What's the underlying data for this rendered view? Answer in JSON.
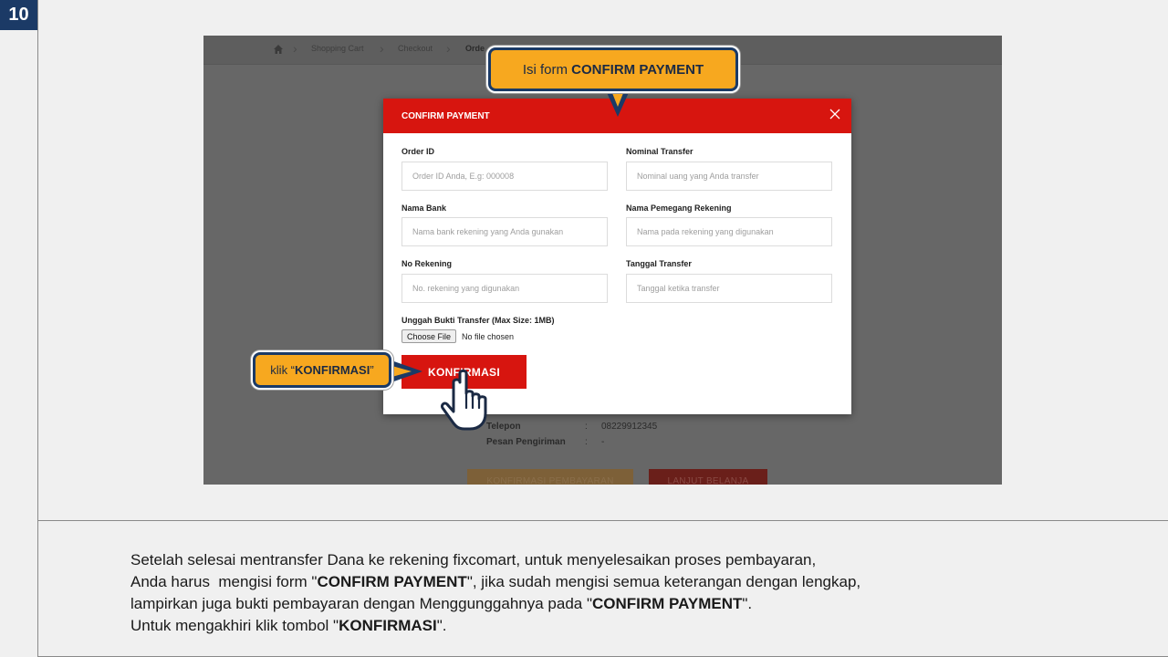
{
  "step_number": "10",
  "screenshot": {
    "breadcrumb": {
      "home_icon": "home-icon",
      "items": [
        "Shopping Cart",
        "Checkout",
        "Orde"
      ]
    },
    "background_details": {
      "telepon_label": "Telepon",
      "telepon_value": "08229912345",
      "pesan_label": "Pesan Pengiriman",
      "pesan_value": "-"
    },
    "background_buttons": {
      "confirm_label": "KONFIRMASI PEMBAYARAN",
      "continue_label": "LANJUT BELANJA"
    },
    "modal": {
      "title": "CONFIRM PAYMENT",
      "close_icon": "close-icon",
      "fields": {
        "order_id": {
          "label": "Order ID",
          "placeholder": "Order ID Anda, E.g: 000008"
        },
        "nominal_transfer": {
          "label": "Nominal Transfer",
          "placeholder": "Nominal uang yang Anda transfer"
        },
        "nama_bank": {
          "label": "Nama Bank",
          "placeholder": "Nama bank rekening yang Anda gunakan"
        },
        "nama_pemegang": {
          "label": "Nama Pemegang Rekening",
          "placeholder": "Nama pada rekening yang digunakan"
        },
        "no_rekening": {
          "label": "No Rekening",
          "placeholder": "No. rekening yang digunakan"
        },
        "tanggal_transfer": {
          "label": "Tanggal Transfer",
          "placeholder": "Tanggal ketika transfer"
        }
      },
      "upload": {
        "label": "Unggah Bukti Transfer (Max Size: 1MB)",
        "button_label": "Choose File",
        "status": "No file chosen"
      },
      "submit_label": "KONFIRMASI"
    }
  },
  "callouts": {
    "top": {
      "prefix": "Isi form ",
      "bold": "CONFIRM PAYMENT"
    },
    "left": {
      "prefix": "klik “",
      "bold": "KONFIRMASI",
      "suffix": "”"
    },
    "pointer_icon": "hand-pointer-icon"
  },
  "instructions": {
    "line1": "Setelah selesai mentransfer Dana ke rekening fixcomart, untuk menyelesaikan proses pembayaran,",
    "line2_a": "Anda harus  mengisi form \"",
    "line2_b": "CONFIRM PAYMENT",
    "line2_c": "\", jika sudah mengisi semua keterangan dengan lengkap,",
    "line3_a": "lampirkan juga bukti pembayaran dengan Menggunggahnya pada \"",
    "line3_b": "CONFIRM PAYMENT",
    "line3_c": "\".",
    "line4_a": "Untuk mengakhiri klik tombol \"",
    "line4_b": "KONFIRMASI",
    "line4_c": "\"."
  },
  "colors": {
    "brand_red": "#d7150f",
    "callout_orange": "#f7a81f",
    "navy": "#1b3a66"
  }
}
